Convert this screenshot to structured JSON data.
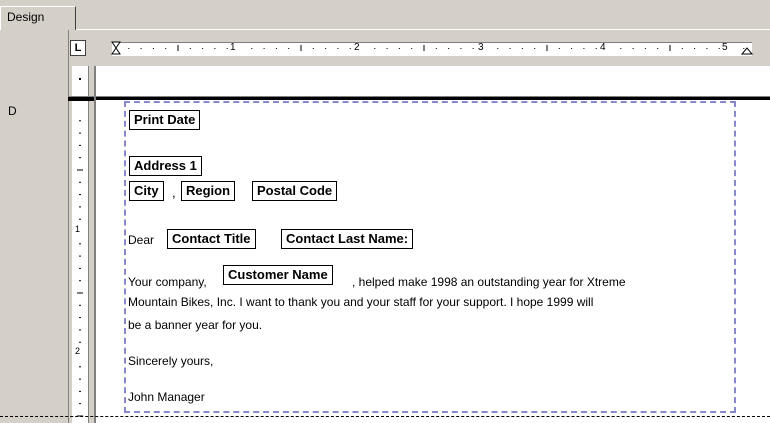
{
  "tab": {
    "label": "Design"
  },
  "ruler": {
    "tab_stop": "L",
    "h_numbers": [
      "1",
      "2",
      "3",
      "4",
      "5"
    ],
    "v_numbers": [
      "1",
      "2"
    ]
  },
  "section": {
    "letter": "D"
  },
  "letter": {
    "print_date": "Print Date",
    "address1": "Address 1",
    "city": "City",
    "comma": ",",
    "region": "Region",
    "postal_code": "Postal Code",
    "dear": "Dear",
    "contact_title": "Contact Title",
    "contact_last_name": "Contact Last Name:",
    "para_start": "Your company,",
    "customer_name": "Customer Name",
    "para_line1_end": ", helped make 1998 an outstanding year for Xtreme",
    "para_line2": "Mountain Bikes, Inc. I want to thank you and your staff for your support. I hope 1999 will",
    "para_line3": "be a banner year for you.",
    "closing": "Sincerely yours,",
    "signature": "John Manager"
  }
}
